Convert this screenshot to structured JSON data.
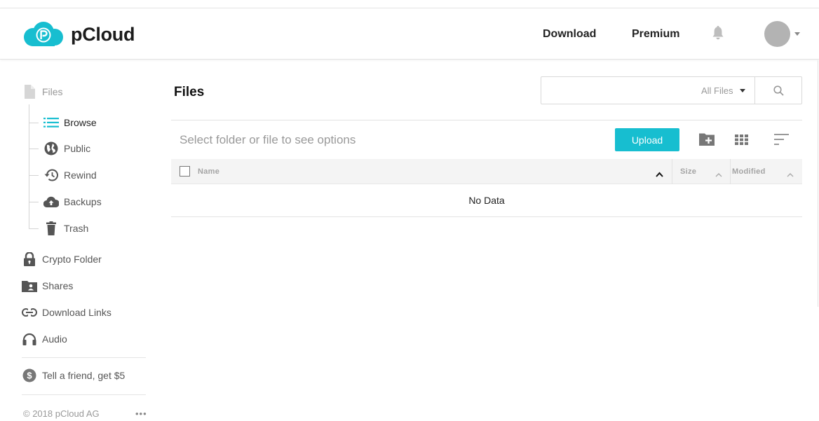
{
  "header": {
    "logo_text": "pCloud",
    "nav": {
      "download": "Download",
      "premium": "Premium"
    },
    "icons": {
      "logo": "pcloud-logo-icon",
      "bell": "bell-icon",
      "avatar": "avatar",
      "avatar_menu": "chevron-down-icon"
    }
  },
  "sidebar": {
    "files_label": "Files",
    "sub_items": [
      {
        "label": "Browse",
        "icon": "list-icon",
        "active": true
      },
      {
        "label": "Public",
        "icon": "globe-icon"
      },
      {
        "label": "Rewind",
        "icon": "rewind-clock-icon"
      },
      {
        "label": "Backups",
        "icon": "cloud-upload-icon"
      },
      {
        "label": "Trash",
        "icon": "trash-icon"
      }
    ],
    "items": [
      {
        "label": "Crypto Folder",
        "icon": "lock-icon"
      },
      {
        "label": "Shares",
        "icon": "shared-folder-icon"
      },
      {
        "label": "Download Links",
        "icon": "link-icon"
      },
      {
        "label": "Audio",
        "icon": "headphones-icon"
      }
    ],
    "referral": {
      "label": "Tell a friend, get $5",
      "icon": "dollar-icon"
    },
    "footer": {
      "copyright": "© 2018 pCloud AG",
      "more": "•••"
    }
  },
  "main": {
    "title": "Files",
    "search": {
      "value": "",
      "placeholder": "",
      "filter_label": "All Files"
    },
    "hint": "Select folder or file to see options",
    "upload_label": "Upload",
    "table": {
      "columns": {
        "name": "Name",
        "size": "Size",
        "modified": "Modified"
      },
      "empty_text": "No Data"
    }
  },
  "colors": {
    "accent": "#17bed0",
    "muted_text": "#999999"
  }
}
